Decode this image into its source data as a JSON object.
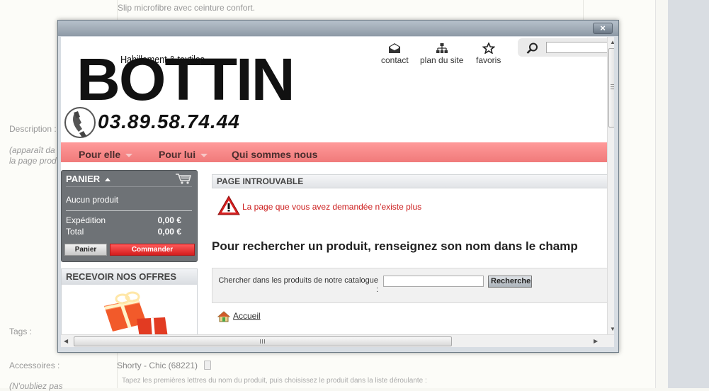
{
  "background": {
    "top_text": "Slip microfibre avec ceinture confort.",
    "description_label": "Description :",
    "description_hint_1": "(apparaît da",
    "description_hint_2": "la page prod",
    "tags_label": "Tags :",
    "accessoires_label": "Accessoires :",
    "accessoire_value": "Shorty - Chic (68221)",
    "oubliez_label": "(N'oubliez pas",
    "tapez_text": "Tapez les premières lettres du nom du produit, puis choisissez le produit dans la liste déroulante :"
  },
  "modal": {
    "close_label": "×"
  },
  "site": {
    "logo_sub": "Habillement & textiles",
    "logo_main": "BOTTIN",
    "phone": "03.89.58.74.44",
    "top_links": [
      {
        "label": "contact"
      },
      {
        "label": "plan du site"
      },
      {
        "label": "favoris"
      }
    ],
    "nav": [
      {
        "label": "Pour elle"
      },
      {
        "label": "Pour lui"
      },
      {
        "label": "Qui sommes nous"
      }
    ]
  },
  "panier": {
    "title": "PANIER",
    "empty": "Aucun produit",
    "expedition_label": "Expédition",
    "expedition_value": "0,00 €",
    "total_label": "Total",
    "total_value": "0,00 €",
    "btn_panier": "Panier",
    "btn_commander": "Commander"
  },
  "offres": {
    "title": "RECEVOIR NOS OFFRES"
  },
  "main": {
    "box_title": "PAGE INTROUVABLE",
    "error_message": "La page que vous avez demandée n'existe plus",
    "headline": "Pour rechercher un produit, renseignez son nom dans le champ",
    "search_label_1": "Chercher dans les produits de notre catalogue",
    "search_label_2": ":",
    "search_button": "Rechercher",
    "home_link": "Accueil"
  },
  "colors": {
    "nav_pink": "#f07a7a",
    "commander_red": "#d41e1e",
    "error_red": "#cc1d1d"
  }
}
